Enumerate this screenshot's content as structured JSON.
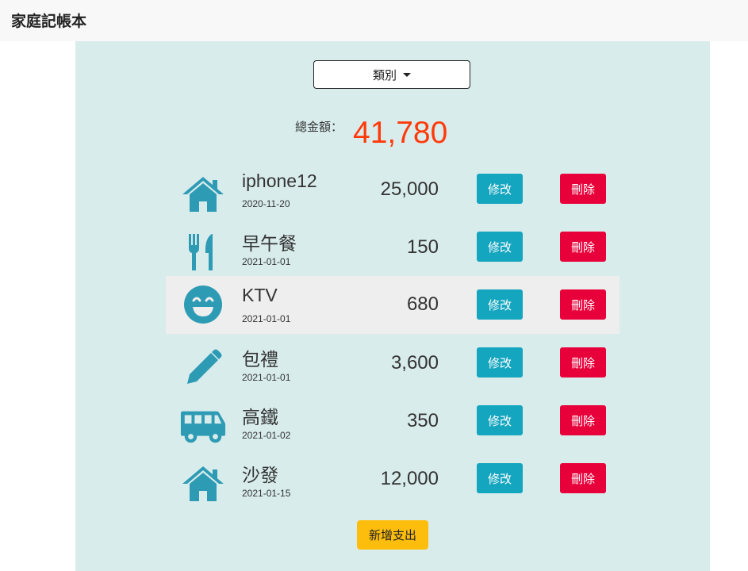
{
  "app": {
    "title": "家庭記帳本"
  },
  "filter": {
    "label": "類別"
  },
  "summary": {
    "total_label": "總金額：",
    "total_value": "41,780"
  },
  "buttons": {
    "edit": "修改",
    "delete": "刪除",
    "add": "新增支出"
  },
  "colors": {
    "panel_bg": "#d9ecec",
    "icon": "#2e9bb5",
    "edit": "#14a5bf",
    "delete": "#e8003a",
    "add": "#fdbd0d",
    "total": "#ff3a0a"
  },
  "records": [
    {
      "icon": "home-icon",
      "name": "iphone12",
      "date": "2020-11-20",
      "amount": "25,000"
    },
    {
      "icon": "utensils-icon",
      "name": "早午餐",
      "date": "2021-01-01",
      "amount": "150"
    },
    {
      "icon": "smile-icon",
      "name": "KTV",
      "date": "2021-01-01",
      "amount": "680"
    },
    {
      "icon": "pencil-icon",
      "name": "包禮",
      "date": "2021-01-01",
      "amount": "3,600"
    },
    {
      "icon": "van-icon",
      "name": "高鐵",
      "date": "2021-01-02",
      "amount": "350"
    },
    {
      "icon": "home-icon",
      "name": "沙發",
      "date": "2021-01-15",
      "amount": "12,000"
    }
  ]
}
